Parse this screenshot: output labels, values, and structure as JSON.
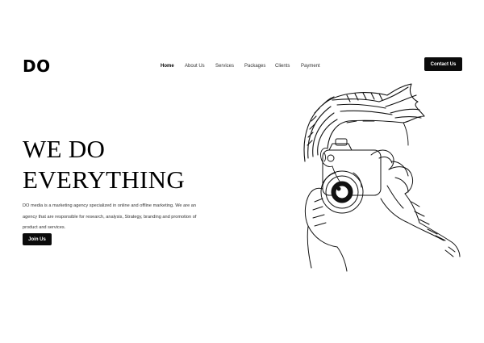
{
  "brand": {
    "logo": "DO"
  },
  "nav": {
    "items": [
      {
        "label": "Home",
        "active": true
      },
      {
        "label": "About Us",
        "active": false
      },
      {
        "label": "Services",
        "active": false
      },
      {
        "label": "Packages",
        "active": false
      },
      {
        "label": "Clients",
        "active": false
      },
      {
        "label": "Payment",
        "active": false
      }
    ]
  },
  "header": {
    "contact_label": "Contact Us"
  },
  "hero": {
    "title_line1": "WE DO",
    "title_line2": "EVERYTHING",
    "description": "DO media is a marketing agency specialized in online and offline marketing. We are an agency that are responsible for research, analysis, Strategy, branding and promotion of product and services.",
    "cta_label": "Join Us"
  },
  "illustration": {
    "icon": "photographer-with-camera-sketch"
  },
  "colors": {
    "background": "#ffffff",
    "button": "#0b0b0b",
    "button_text": "#ffffff",
    "text": "#111111"
  }
}
